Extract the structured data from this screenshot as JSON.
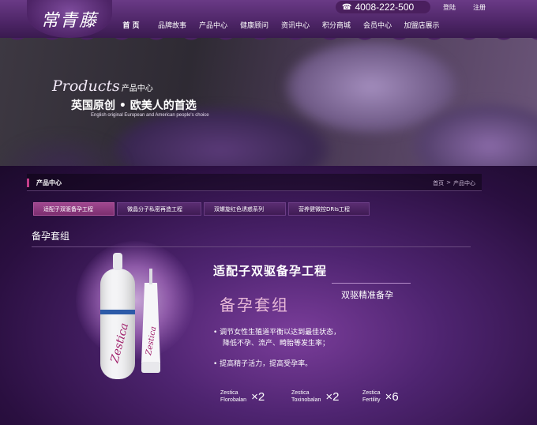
{
  "header": {
    "logo": "常青藤",
    "phone": "4008-222-500",
    "login": "登陆",
    "register": "注册",
    "nav": [
      "首 页",
      "品牌故事",
      "产品中心",
      "健康顾问",
      "资讯中心",
      "积分商城",
      "会员中心",
      "加盟店展示"
    ]
  },
  "banner": {
    "script": "Products",
    "title_cn": "产品中心",
    "slogan": "英国原创 • 欧美人的首选",
    "slogan_en": "English original European and American people's choice"
  },
  "section": {
    "title": "产品中心",
    "breadcrumb": [
      "首页",
      ">",
      "产品中心"
    ]
  },
  "tabs": [
    "适配子双驱备孕工程",
    "微晶分子私密再造工程",
    "双螺旋红色诱惑系列",
    "营养健微控DRIs工程"
  ],
  "subheading": "备孕套组",
  "product": {
    "title": "适配子双驱备孕工程",
    "subtitle": "双驱精准备孕",
    "set_name": "备孕套组",
    "bottle_brand": "Zestica",
    "tube_brand": "Zestica",
    "bullets": [
      "• 调节女性生殖道平衡以达到最佳状态，",
      "降低不孕、流产、畸胎等发生率；",
      "• 提高精子活力，提高受孕率。"
    ],
    "items": [
      {
        "line1": "Zestica",
        "line2": "Florobalan",
        "qty": "×2"
      },
      {
        "line1": "Zestica",
        "line2": "Toxinobalan",
        "qty": "×2"
      },
      {
        "line1": "Zestica",
        "line2": "Fertility",
        "qty": "×6"
      }
    ]
  },
  "colors": {
    "header": "#4d2566",
    "accent": "#c43d8a",
    "tab_active": "#a0478f",
    "set_text": "#e8b9d8"
  }
}
